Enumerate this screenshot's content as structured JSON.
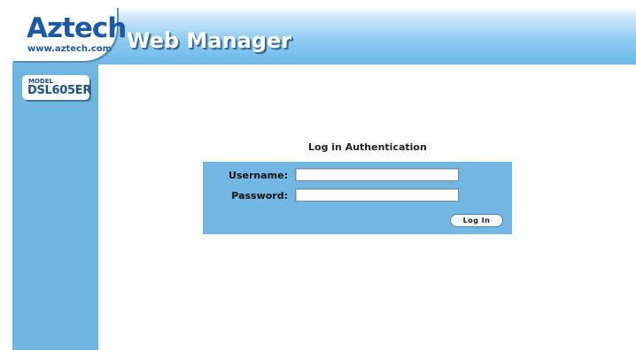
{
  "brand": {
    "logo": "Aztech",
    "url": "www.aztech.com",
    "app_title": "Web Manager"
  },
  "model": {
    "label": "MODEL",
    "name": "DSL605ER"
  },
  "login": {
    "title": "Log in Authentication",
    "username_label": "Username:",
    "username_value": "",
    "password_label": "Password:",
    "password_value": "",
    "button_label": "Log In"
  },
  "colors": {
    "sidebar": "#6fb6e3",
    "login_box": "#72b7e4",
    "logo_blue": "#1d5aa6"
  }
}
